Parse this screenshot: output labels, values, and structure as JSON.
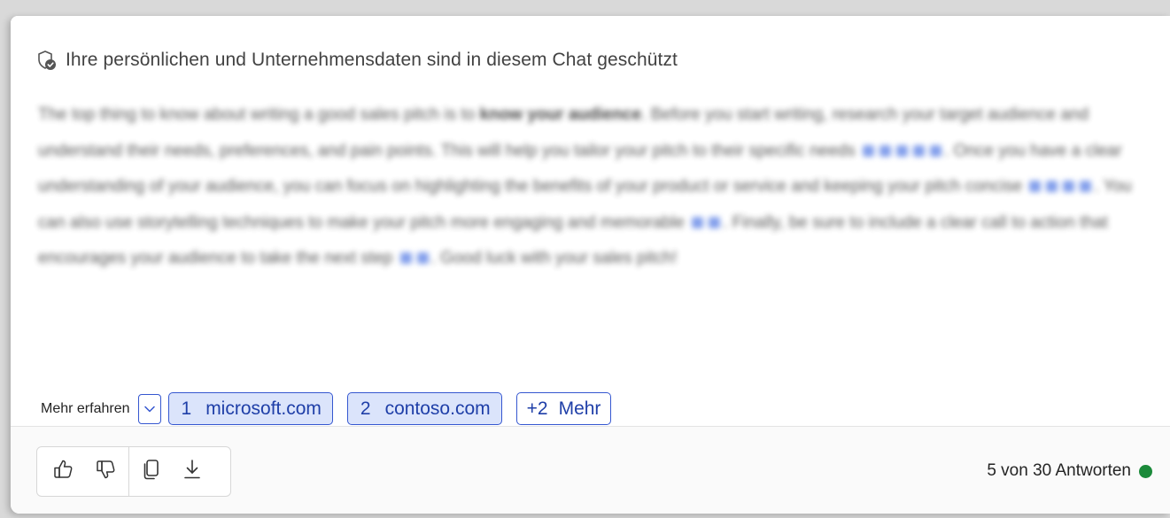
{
  "privacy": {
    "icon": "shield-check-icon",
    "text": "Ihre persönlichen und Unternehmensdaten sind in diesem Chat geschützt"
  },
  "answer": {
    "part1": "The top thing to know about writing a good sales pitch is to ",
    "bold": "know your audience",
    "part2": ". Before you start writing, research your target audience and understand their needs, preferences, and pain points. This will help you tailor your pitch to their specific needs",
    "part3": ". Once you have a clear understanding of your audience, you can focus on highlighting the benefits of your product or service and keeping your pitch concise",
    "part4": ". You can also use storytelling techniques to make your pitch more engaging and memorable",
    "part5": ". Finally, be sure to include a clear call to action that encourages your audience to take the next step",
    "part6": ". Good luck with your sales pitch!"
  },
  "learn_more": {
    "label": "Mehr erfahren",
    "expand_icon": "chevron-down-icon",
    "sources": [
      {
        "num": "1",
        "label": "microsoft.com"
      },
      {
        "num": "2",
        "label": "contoso.com"
      }
    ],
    "more": {
      "num": "+2",
      "label": "Mehr"
    }
  },
  "toolbar": {
    "icons": [
      "thumbs-up-icon",
      "thumbs-down-icon",
      "copy-icon",
      "download-icon"
    ]
  },
  "status": {
    "text": "5 von 30 Antworten",
    "color": "#1b8a3a"
  }
}
